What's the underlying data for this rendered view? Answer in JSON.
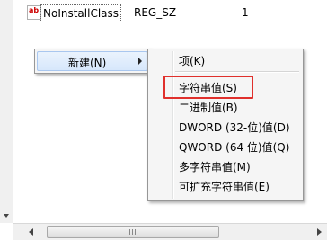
{
  "registry_row": {
    "icon": "ab-string-value-icon",
    "icon_text": "ab",
    "name": "NoInstallClass",
    "type": "REG_SZ",
    "data": "1"
  },
  "context_menu": {
    "new_label": "新建(N)"
  },
  "submenu": {
    "items": [
      "项(K)",
      "字符串值(S)",
      "二进制值(B)",
      "DWORD (32-位)值(D)",
      "QWORD (64 位)值(Q)",
      "多字符串值(M)",
      "可扩充字符串值(E)"
    ]
  },
  "colors": {
    "highlight_border": "#e0302c",
    "menu_background": "#f5f5f5"
  }
}
